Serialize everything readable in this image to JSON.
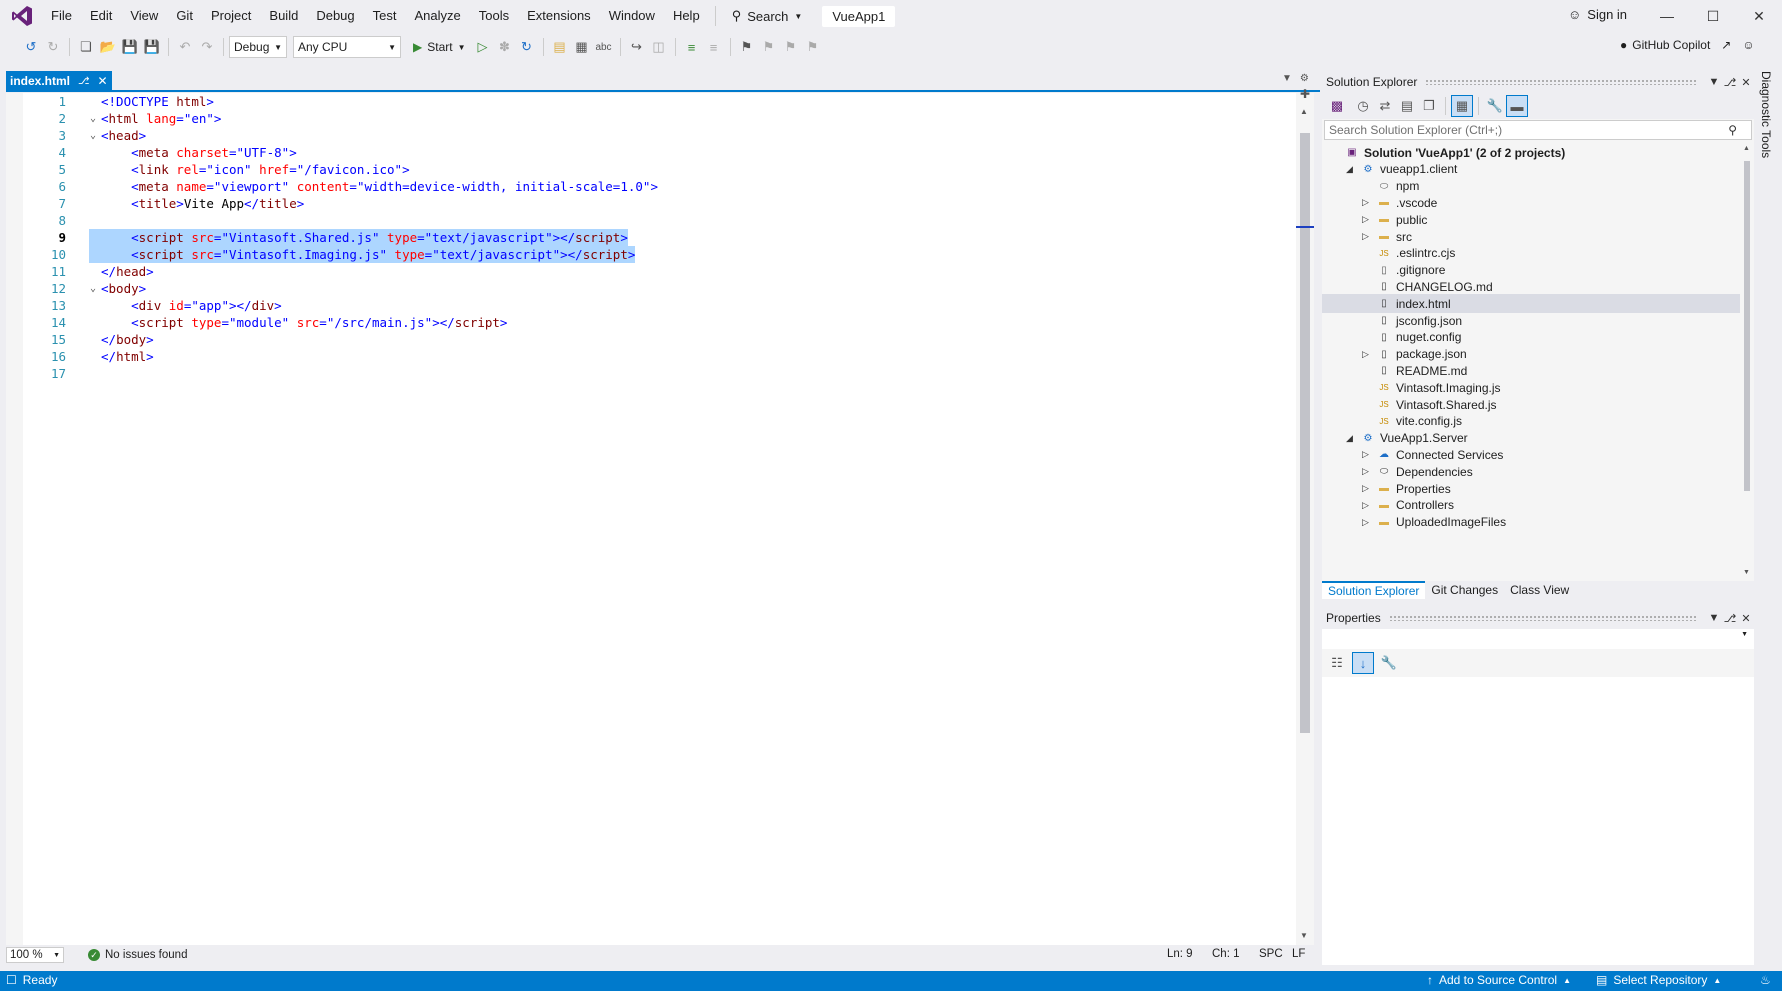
{
  "menu": {
    "items": [
      "File",
      "Edit",
      "View",
      "Git",
      "Project",
      "Build",
      "Debug",
      "Test",
      "Analyze",
      "Tools",
      "Extensions",
      "Window",
      "Help"
    ],
    "search_label": "Search",
    "solution_title": "VueApp1",
    "signin_label": "Sign in"
  },
  "toolbar": {
    "config": "Debug",
    "platform": "Any CPU",
    "start_label": "Start",
    "copilot_label": "GitHub Copilot"
  },
  "editor": {
    "tab_label": "index.html",
    "current_line": 9,
    "lines": [
      {
        "n": "1",
        "fold": "",
        "html": [
          [
            "br",
            "<!DOCTYPE "
          ],
          [
            "tag",
            "html"
          ],
          [
            "br",
            ">"
          ]
        ]
      },
      {
        "n": "2",
        "fold": "v",
        "html": [
          [
            "br",
            "<"
          ],
          [
            "tag",
            "html"
          ],
          [
            "txt",
            " "
          ],
          [
            "attr",
            "lang"
          ],
          [
            "br",
            "="
          ],
          [
            "val",
            "\"en\""
          ],
          [
            "br",
            ">"
          ]
        ]
      },
      {
        "n": "3",
        "fold": "v",
        "html": [
          [
            "br",
            "<"
          ],
          [
            "tag",
            "head"
          ],
          [
            "br",
            ">"
          ]
        ]
      },
      {
        "n": "4",
        "fold": "",
        "html": [
          [
            "txt",
            "    "
          ],
          [
            "br",
            "<"
          ],
          [
            "tag",
            "meta"
          ],
          [
            "txt",
            " "
          ],
          [
            "attr",
            "charset"
          ],
          [
            "br",
            "="
          ],
          [
            "val",
            "\"UTF-8\""
          ],
          [
            "br",
            ">"
          ]
        ]
      },
      {
        "n": "5",
        "fold": "",
        "html": [
          [
            "txt",
            "    "
          ],
          [
            "br",
            "<"
          ],
          [
            "tag",
            "link"
          ],
          [
            "txt",
            " "
          ],
          [
            "attr",
            "rel"
          ],
          [
            "br",
            "="
          ],
          [
            "val",
            "\"icon\""
          ],
          [
            "txt",
            " "
          ],
          [
            "attr",
            "href"
          ],
          [
            "br",
            "="
          ],
          [
            "val",
            "\"/favicon.ico\""
          ],
          [
            "br",
            ">"
          ]
        ]
      },
      {
        "n": "6",
        "fold": "",
        "html": [
          [
            "txt",
            "    "
          ],
          [
            "br",
            "<"
          ],
          [
            "tag",
            "meta"
          ],
          [
            "txt",
            " "
          ],
          [
            "attr",
            "name"
          ],
          [
            "br",
            "="
          ],
          [
            "val",
            "\"viewport\""
          ],
          [
            "txt",
            " "
          ],
          [
            "attr",
            "content"
          ],
          [
            "br",
            "="
          ],
          [
            "val",
            "\"width=device-width, initial-scale=1.0\""
          ],
          [
            "br",
            ">"
          ]
        ]
      },
      {
        "n": "7",
        "fold": "",
        "html": [
          [
            "txt",
            "    "
          ],
          [
            "br",
            "<"
          ],
          [
            "tag",
            "title"
          ],
          [
            "br",
            ">"
          ],
          [
            "txt",
            "Vite App"
          ],
          [
            "br",
            "</"
          ],
          [
            "tag",
            "title"
          ],
          [
            "br",
            ">"
          ]
        ]
      },
      {
        "n": "8",
        "fold": "",
        "html": []
      },
      {
        "n": "9",
        "fold": "",
        "sel": true,
        "html": [
          [
            "txt",
            "    "
          ],
          [
            "br",
            "<"
          ],
          [
            "tag",
            "script"
          ],
          [
            "txt",
            " "
          ],
          [
            "attr",
            "src"
          ],
          [
            "br",
            "="
          ],
          [
            "val",
            "\"Vintasoft.Shared.js\""
          ],
          [
            "txt",
            " "
          ],
          [
            "attr",
            "type"
          ],
          [
            "br",
            "="
          ],
          [
            "val",
            "\"text/javascript\""
          ],
          [
            "br",
            "></"
          ],
          [
            "tag",
            "script"
          ],
          [
            "br",
            ">"
          ]
        ]
      },
      {
        "n": "10",
        "fold": "",
        "sel": true,
        "html": [
          [
            "txt",
            "    "
          ],
          [
            "br",
            "<"
          ],
          [
            "tag",
            "script"
          ],
          [
            "txt",
            " "
          ],
          [
            "attr",
            "src"
          ],
          [
            "br",
            "="
          ],
          [
            "val",
            "\"Vintasoft.Imaging.js\""
          ],
          [
            "txt",
            " "
          ],
          [
            "attr",
            "type"
          ],
          [
            "br",
            "="
          ],
          [
            "val",
            "\"text/javascript\""
          ],
          [
            "br",
            "></"
          ],
          [
            "tag",
            "script"
          ],
          [
            "br",
            ">"
          ]
        ]
      },
      {
        "n": "11",
        "fold": "",
        "html": [
          [
            "br",
            "</"
          ],
          [
            "tag",
            "head"
          ],
          [
            "br",
            ">"
          ]
        ]
      },
      {
        "n": "12",
        "fold": "v",
        "html": [
          [
            "br",
            "<"
          ],
          [
            "tag",
            "body"
          ],
          [
            "br",
            ">"
          ]
        ]
      },
      {
        "n": "13",
        "fold": "",
        "html": [
          [
            "txt",
            "    "
          ],
          [
            "br",
            "<"
          ],
          [
            "tag",
            "div"
          ],
          [
            "txt",
            " "
          ],
          [
            "attr",
            "id"
          ],
          [
            "br",
            "="
          ],
          [
            "val",
            "\"app\""
          ],
          [
            "br",
            "></"
          ],
          [
            "tag",
            "div"
          ],
          [
            "br",
            ">"
          ]
        ]
      },
      {
        "n": "14",
        "fold": "",
        "html": [
          [
            "txt",
            "    "
          ],
          [
            "br",
            "<"
          ],
          [
            "tag",
            "script"
          ],
          [
            "txt",
            " "
          ],
          [
            "attr",
            "type"
          ],
          [
            "br",
            "="
          ],
          [
            "val",
            "\"module\""
          ],
          [
            "txt",
            " "
          ],
          [
            "attr",
            "src"
          ],
          [
            "br",
            "="
          ],
          [
            "val",
            "\"/src/main.js\""
          ],
          [
            "br",
            "></"
          ],
          [
            "tag",
            "script"
          ],
          [
            "br",
            ">"
          ]
        ]
      },
      {
        "n": "15",
        "fold": "",
        "html": [
          [
            "br",
            "</"
          ],
          [
            "tag",
            "body"
          ],
          [
            "br",
            ">"
          ]
        ]
      },
      {
        "n": "16",
        "fold": "",
        "html": [
          [
            "br",
            "</"
          ],
          [
            "tag",
            "html"
          ],
          [
            "br",
            ">"
          ]
        ]
      },
      {
        "n": "17",
        "fold": "",
        "html": []
      }
    ]
  },
  "editor_status": {
    "zoom": "100 %",
    "issues": "No issues found",
    "ln": "Ln: 9",
    "ch": "Ch: 1",
    "spc": "SPC",
    "lf": "LF"
  },
  "solution_explorer": {
    "title": "Solution Explorer",
    "search_placeholder": "Search Solution Explorer (Ctrl+;)",
    "items": [
      {
        "label": "Solution 'VueApp1' (2 of 2 projects)",
        "level": 0,
        "tri": "",
        "icon": "solution-icon",
        "bold": true
      },
      {
        "label": "vueapp1.client",
        "level": 1,
        "tri": "open",
        "icon": "project-icon"
      },
      {
        "label": "npm",
        "level": 2,
        "tri": "",
        "icon": "npm-icon"
      },
      {
        "label": ".vscode",
        "level": 2,
        "tri": "closed",
        "icon": "folder-icon"
      },
      {
        "label": "public",
        "level": 2,
        "tri": "closed",
        "icon": "folder-icon"
      },
      {
        "label": "src",
        "level": 2,
        "tri": "closed",
        "icon": "folder-icon"
      },
      {
        "label": ".eslintrc.cjs",
        "level": 2,
        "tri": "",
        "icon": "js-icon"
      },
      {
        "label": ".gitignore",
        "level": 2,
        "tri": "",
        "icon": "file-icon"
      },
      {
        "label": "CHANGELOG.md",
        "level": 2,
        "tri": "",
        "icon": "md-icon"
      },
      {
        "label": "index.html",
        "level": 2,
        "tri": "",
        "icon": "html-icon",
        "selected": true
      },
      {
        "label": "jsconfig.json",
        "level": 2,
        "tri": "",
        "icon": "json-icon"
      },
      {
        "label": "nuget.config",
        "level": 2,
        "tri": "",
        "icon": "config-icon"
      },
      {
        "label": "package.json",
        "level": 2,
        "tri": "closed",
        "icon": "json-icon"
      },
      {
        "label": "README.md",
        "level": 2,
        "tri": "",
        "icon": "md-icon"
      },
      {
        "label": "Vintasoft.Imaging.js",
        "level": 2,
        "tri": "",
        "icon": "js-icon"
      },
      {
        "label": "Vintasoft.Shared.js",
        "level": 2,
        "tri": "",
        "icon": "js-icon"
      },
      {
        "label": "vite.config.js",
        "level": 2,
        "tri": "",
        "icon": "js-icon"
      },
      {
        "label": "VueApp1.Server",
        "level": 1,
        "tri": "open",
        "icon": "web-project-icon"
      },
      {
        "label": "Connected Services",
        "level": 2,
        "tri": "closed",
        "icon": "connected-services-icon"
      },
      {
        "label": "Dependencies",
        "level": 2,
        "tri": "closed",
        "icon": "dependencies-icon"
      },
      {
        "label": "Properties",
        "level": 2,
        "tri": "closed",
        "icon": "properties-folder-icon"
      },
      {
        "label": "Controllers",
        "level": 2,
        "tri": "closed",
        "icon": "folder-icon"
      },
      {
        "label": "UploadedImageFiles",
        "level": 2,
        "tri": "closed",
        "icon": "folder-icon"
      }
    ],
    "tabs": [
      "Solution Explorer",
      "Git Changes",
      "Class View"
    ]
  },
  "properties": {
    "title": "Properties"
  },
  "diagnostic_tools_label": "Diagnostic Tools",
  "statusbar": {
    "ready": "Ready",
    "source_control": "Add to Source Control",
    "repository": "Select Repository"
  },
  "colors": {
    "accent": "#007acc",
    "selection": "#add6ff",
    "tag": "#800000",
    "attr": "#ff0000",
    "value": "#0000ff"
  }
}
